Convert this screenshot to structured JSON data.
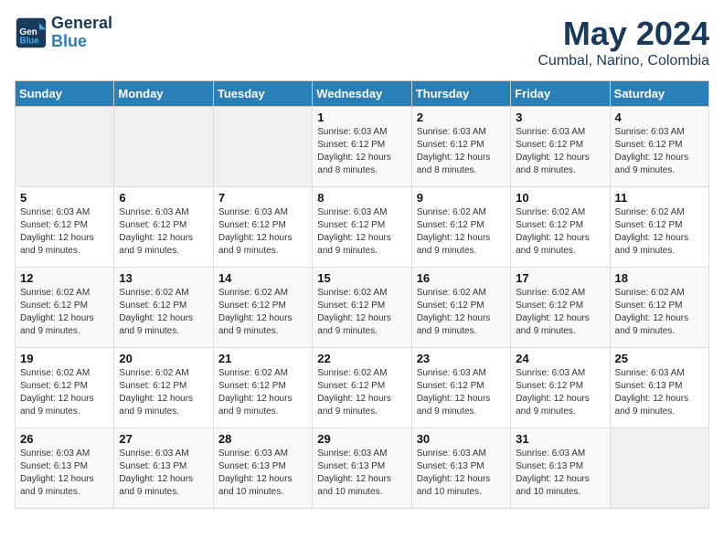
{
  "header": {
    "logo_line1": "General",
    "logo_line2": "Blue",
    "month": "May 2024",
    "location": "Cumbal, Narino, Colombia"
  },
  "days_of_week": [
    "Sunday",
    "Monday",
    "Tuesday",
    "Wednesday",
    "Thursday",
    "Friday",
    "Saturday"
  ],
  "weeks": [
    [
      {
        "day": "",
        "info": ""
      },
      {
        "day": "",
        "info": ""
      },
      {
        "day": "",
        "info": ""
      },
      {
        "day": "1",
        "info": "Sunrise: 6:03 AM\nSunset: 6:12 PM\nDaylight: 12 hours\nand 8 minutes."
      },
      {
        "day": "2",
        "info": "Sunrise: 6:03 AM\nSunset: 6:12 PM\nDaylight: 12 hours\nand 8 minutes."
      },
      {
        "day": "3",
        "info": "Sunrise: 6:03 AM\nSunset: 6:12 PM\nDaylight: 12 hours\nand 8 minutes."
      },
      {
        "day": "4",
        "info": "Sunrise: 6:03 AM\nSunset: 6:12 PM\nDaylight: 12 hours\nand 9 minutes."
      }
    ],
    [
      {
        "day": "5",
        "info": "Sunrise: 6:03 AM\nSunset: 6:12 PM\nDaylight: 12 hours\nand 9 minutes."
      },
      {
        "day": "6",
        "info": "Sunrise: 6:03 AM\nSunset: 6:12 PM\nDaylight: 12 hours\nand 9 minutes."
      },
      {
        "day": "7",
        "info": "Sunrise: 6:03 AM\nSunset: 6:12 PM\nDaylight: 12 hours\nand 9 minutes."
      },
      {
        "day": "8",
        "info": "Sunrise: 6:03 AM\nSunset: 6:12 PM\nDaylight: 12 hours\nand 9 minutes."
      },
      {
        "day": "9",
        "info": "Sunrise: 6:02 AM\nSunset: 6:12 PM\nDaylight: 12 hours\nand 9 minutes."
      },
      {
        "day": "10",
        "info": "Sunrise: 6:02 AM\nSunset: 6:12 PM\nDaylight: 12 hours\nand 9 minutes."
      },
      {
        "day": "11",
        "info": "Sunrise: 6:02 AM\nSunset: 6:12 PM\nDaylight: 12 hours\nand 9 minutes."
      }
    ],
    [
      {
        "day": "12",
        "info": "Sunrise: 6:02 AM\nSunset: 6:12 PM\nDaylight: 12 hours\nand 9 minutes."
      },
      {
        "day": "13",
        "info": "Sunrise: 6:02 AM\nSunset: 6:12 PM\nDaylight: 12 hours\nand 9 minutes."
      },
      {
        "day": "14",
        "info": "Sunrise: 6:02 AM\nSunset: 6:12 PM\nDaylight: 12 hours\nand 9 minutes."
      },
      {
        "day": "15",
        "info": "Sunrise: 6:02 AM\nSunset: 6:12 PM\nDaylight: 12 hours\nand 9 minutes."
      },
      {
        "day": "16",
        "info": "Sunrise: 6:02 AM\nSunset: 6:12 PM\nDaylight: 12 hours\nand 9 minutes."
      },
      {
        "day": "17",
        "info": "Sunrise: 6:02 AM\nSunset: 6:12 PM\nDaylight: 12 hours\nand 9 minutes."
      },
      {
        "day": "18",
        "info": "Sunrise: 6:02 AM\nSunset: 6:12 PM\nDaylight: 12 hours\nand 9 minutes."
      }
    ],
    [
      {
        "day": "19",
        "info": "Sunrise: 6:02 AM\nSunset: 6:12 PM\nDaylight: 12 hours\nand 9 minutes."
      },
      {
        "day": "20",
        "info": "Sunrise: 6:02 AM\nSunset: 6:12 PM\nDaylight: 12 hours\nand 9 minutes."
      },
      {
        "day": "21",
        "info": "Sunrise: 6:02 AM\nSunset: 6:12 PM\nDaylight: 12 hours\nand 9 minutes."
      },
      {
        "day": "22",
        "info": "Sunrise: 6:02 AM\nSunset: 6:12 PM\nDaylight: 12 hours\nand 9 minutes."
      },
      {
        "day": "23",
        "info": "Sunrise: 6:03 AM\nSunset: 6:12 PM\nDaylight: 12 hours\nand 9 minutes."
      },
      {
        "day": "24",
        "info": "Sunrise: 6:03 AM\nSunset: 6:12 PM\nDaylight: 12 hours\nand 9 minutes."
      },
      {
        "day": "25",
        "info": "Sunrise: 6:03 AM\nSunset: 6:13 PM\nDaylight: 12 hours\nand 9 minutes."
      }
    ],
    [
      {
        "day": "26",
        "info": "Sunrise: 6:03 AM\nSunset: 6:13 PM\nDaylight: 12 hours\nand 9 minutes."
      },
      {
        "day": "27",
        "info": "Sunrise: 6:03 AM\nSunset: 6:13 PM\nDaylight: 12 hours\nand 9 minutes."
      },
      {
        "day": "28",
        "info": "Sunrise: 6:03 AM\nSunset: 6:13 PM\nDaylight: 12 hours\nand 10 minutes."
      },
      {
        "day": "29",
        "info": "Sunrise: 6:03 AM\nSunset: 6:13 PM\nDaylight: 12 hours\nand 10 minutes."
      },
      {
        "day": "30",
        "info": "Sunrise: 6:03 AM\nSunset: 6:13 PM\nDaylight: 12 hours\nand 10 minutes."
      },
      {
        "day": "31",
        "info": "Sunrise: 6:03 AM\nSunset: 6:13 PM\nDaylight: 12 hours\nand 10 minutes."
      },
      {
        "day": "",
        "info": ""
      }
    ]
  ]
}
